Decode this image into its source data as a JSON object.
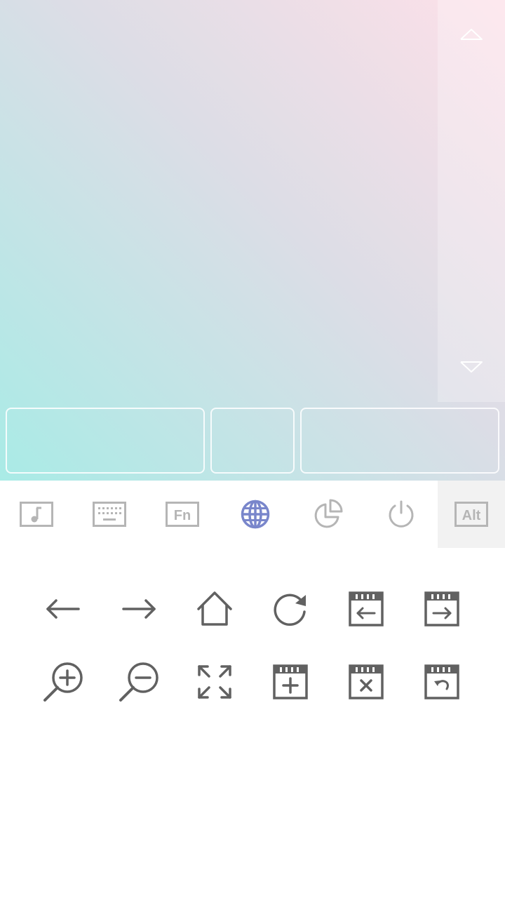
{
  "colors": {
    "gradient_top_right": "#fde0e8",
    "gradient_bottom_left": "#a9ebe6",
    "tab_inactive": "#b5b5b5",
    "tab_active": "#7986cb",
    "action_icon": "#616161",
    "selected_tab_bg": "#f2f2f2"
  },
  "touchpad": {
    "scroll_up_icon": "triangle-up-outline",
    "scroll_down_icon": "triangle-down-outline",
    "buttons": [
      "left-click",
      "middle-click",
      "right-click"
    ]
  },
  "tabs": [
    {
      "id": "media",
      "icon": "music-note-box",
      "active": false
    },
    {
      "id": "keyboard",
      "icon": "keyboard",
      "active": false
    },
    {
      "id": "function",
      "icon": "fn-box",
      "label": "Fn",
      "active": false
    },
    {
      "id": "browser",
      "icon": "globe",
      "active": true
    },
    {
      "id": "presentation",
      "icon": "pie-chart",
      "active": false
    },
    {
      "id": "power",
      "icon": "power",
      "active": false
    },
    {
      "id": "alt",
      "icon": "alt-box",
      "label": "Alt",
      "active": false
    }
  ],
  "browser_actions": [
    {
      "id": "back",
      "icon": "arrow-left"
    },
    {
      "id": "forward",
      "icon": "arrow-right"
    },
    {
      "id": "home",
      "icon": "home"
    },
    {
      "id": "refresh",
      "icon": "refresh"
    },
    {
      "id": "previous-tab",
      "icon": "tab-arrow-left"
    },
    {
      "id": "next-tab",
      "icon": "tab-arrow-right"
    },
    {
      "id": "zoom-in",
      "icon": "zoom-in"
    },
    {
      "id": "zoom-out",
      "icon": "zoom-out"
    },
    {
      "id": "fullscreen",
      "icon": "fullscreen"
    },
    {
      "id": "new-tab",
      "icon": "tab-plus"
    },
    {
      "id": "close-tab",
      "icon": "tab-close"
    },
    {
      "id": "reopen-tab",
      "icon": "tab-undo"
    }
  ]
}
